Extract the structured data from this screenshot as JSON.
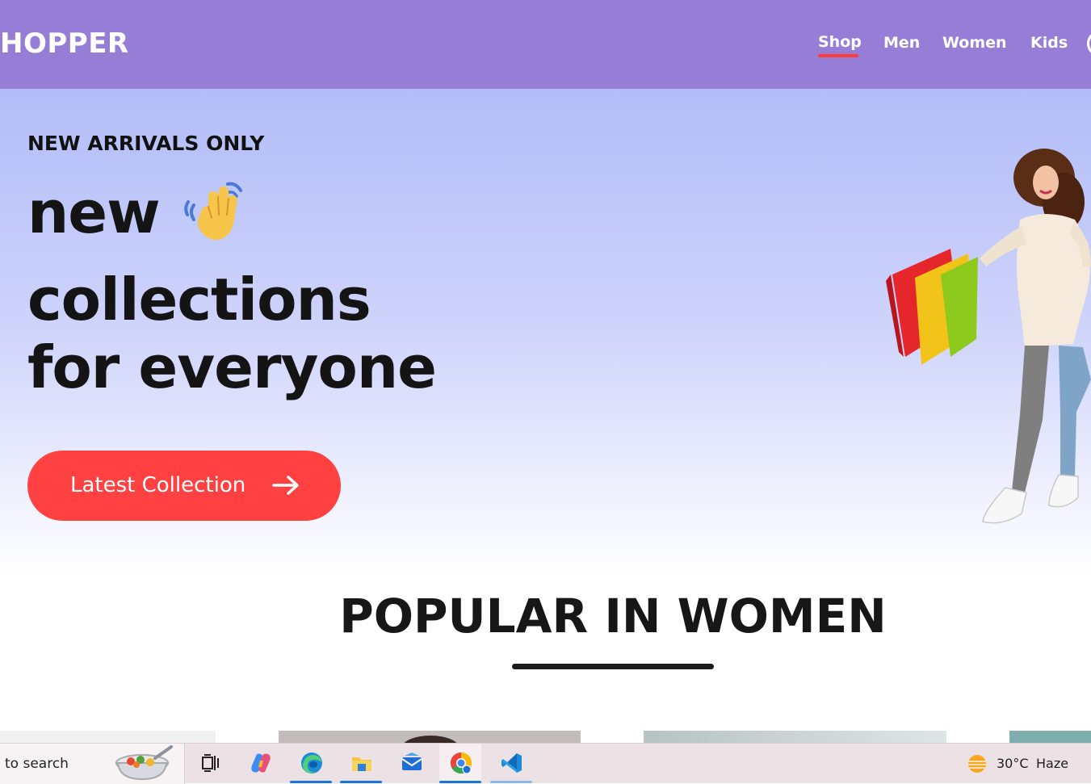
{
  "header": {
    "logo": "HOPPER",
    "nav": {
      "shop": "Shop",
      "men": "Men",
      "women": "Women",
      "kids": "Kids"
    },
    "active_nav": "Shop",
    "background_color": "#967ed6",
    "active_underline_color": "#ff3b3b"
  },
  "hero": {
    "eyebrow": "NEW ARRIVALS ONLY",
    "line1": "new",
    "line2": "collections",
    "line3": "for everyone",
    "cta_label": "Latest Collection",
    "cta_color": "#ff4141",
    "wave_icon": "waving-hand-icon",
    "arrow_icon": "arrow-right-icon"
  },
  "popular": {
    "title": "POPULAR IN WOMEN"
  },
  "taskbar": {
    "search_text": "to search",
    "apps": [
      "task-view-icon",
      "copilot-icon",
      "edge-icon",
      "file-explorer-icon",
      "mail-icon",
      "chrome-icon",
      "vscode-icon"
    ],
    "weather": {
      "temperature": "30°C",
      "condition": "Haze"
    },
    "accent_color": "#1a73d6"
  }
}
